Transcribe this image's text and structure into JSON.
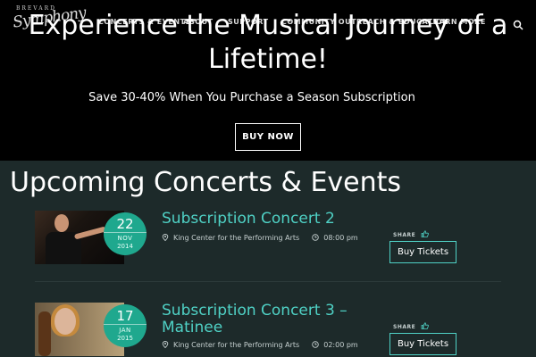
{
  "brand": {
    "small": "BREVARD",
    "script": "Symphony"
  },
  "nav": {
    "items": [
      "CONCERTS & EVENTS",
      "ABOUT",
      "SUPPORT",
      "COMMUNITY OUTREACH & EDUCATION",
      "LEARN MORE"
    ]
  },
  "hero": {
    "title_line1": "Experience the Musical Journey of a",
    "title_line2": "Lifetime!",
    "subtitle": "Save 30-40% When You Purchase a Season Subscription",
    "button": "BUY NOW"
  },
  "events_section": {
    "title": "Upcoming Concerts & Events",
    "events": [
      {
        "day": "22",
        "month": "NOV",
        "year": "2014",
        "title": "Subscription Concert 2",
        "venue": "King Center for the Performing Arts",
        "time": "08:00 pm",
        "share": "SHARE",
        "button": "Buy Tickets"
      },
      {
        "day": "17",
        "month": "JAN",
        "year": "2015",
        "title": "Subscription Concert 3 – Matinee",
        "venue": "King Center for the Performing Arts",
        "time": "02:00 pm",
        "share": "SHARE",
        "button": "Buy Tickets"
      }
    ]
  },
  "colors": {
    "accent": "#4fd1c5",
    "badge": "#1fa88e",
    "section_bg": "#1d2a2a",
    "hero_bg": "#000000"
  },
  "icons": [
    "search-icon",
    "pin-icon",
    "clock-icon",
    "thumbs-up-icon"
  ]
}
